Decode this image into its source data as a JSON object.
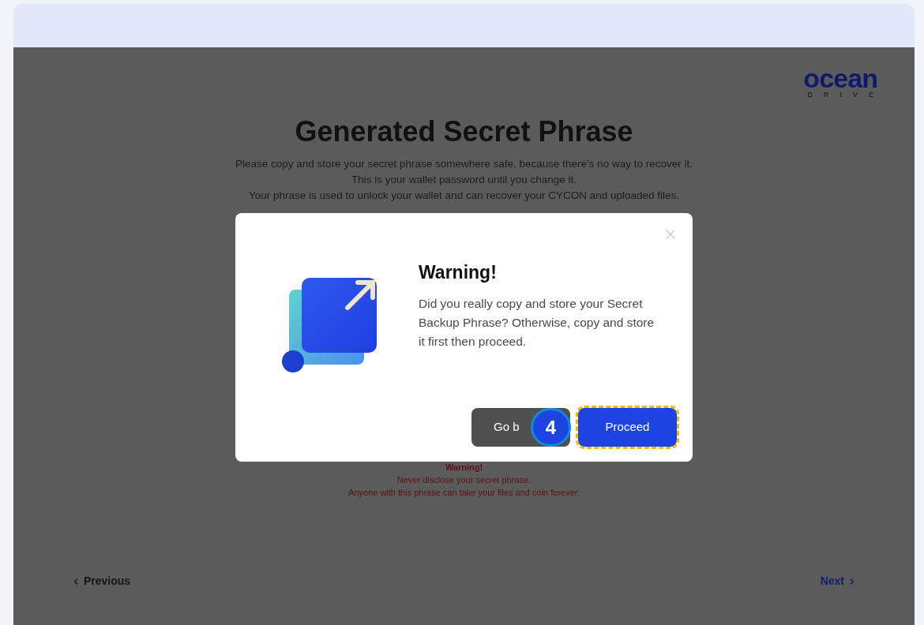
{
  "logo": {
    "wordmark": "ocean",
    "subtitle": "DRIVE"
  },
  "page": {
    "title": "Generated Secret Phrase",
    "intro_lines": [
      "Please copy and store your secret phrase somewhere safe, because there's no way to recover it.",
      "This is your wallet password until you change it.",
      "Your phrase is used to unlock your wallet and can recover your CYCON and uploaded files."
    ],
    "warning": {
      "title": "Warning!",
      "lines": [
        "Never disclose your secret phrase.",
        "Anyone with this phrase can take your files and coin forever."
      ]
    },
    "nav": {
      "previous": "Previous",
      "next": "Next"
    }
  },
  "dialog": {
    "title": "Warning!",
    "message": "Did you really copy and store your Secret Backup Phrase? Otherwise, copy and store it first then proceed.",
    "buttons": [
      {
        "label": "Go b",
        "kind": "secondary",
        "highlighted": false
      },
      {
        "label": "Proceed",
        "kind": "primary",
        "highlighted": true
      }
    ],
    "step_badge": "4"
  }
}
